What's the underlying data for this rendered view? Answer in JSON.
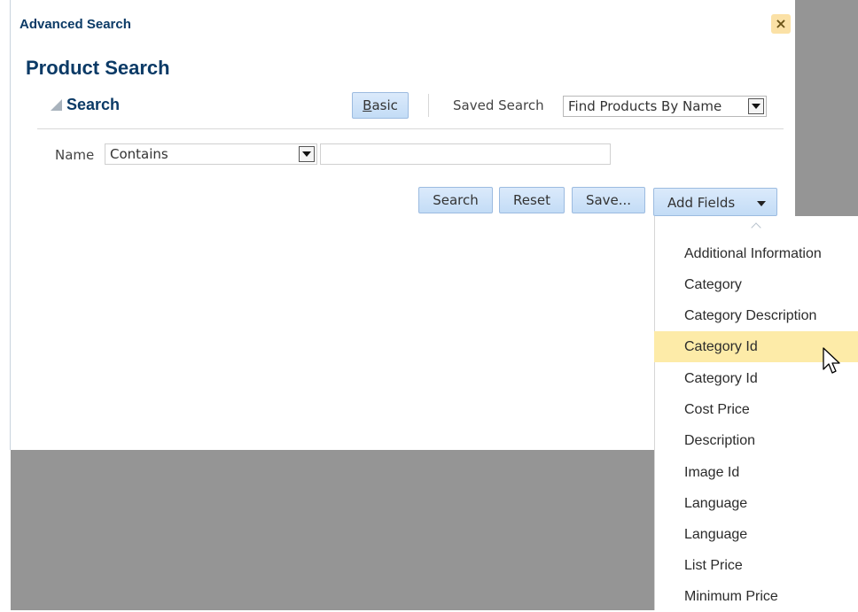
{
  "dialog": {
    "title": "Advanced Search",
    "close_icon": "×"
  },
  "page": {
    "title": "Product Search"
  },
  "search": {
    "header": "Search",
    "basic_button": {
      "u": "B",
      "rest": "asic"
    },
    "saved_search_label": "Saved Search",
    "saved_search_value": "Find Products By Name",
    "field_label": "Name",
    "operator": "Contains",
    "value": ""
  },
  "actions": {
    "search": "Search",
    "reset": "Reset",
    "save": "Save...",
    "add_fields": "Add Fields"
  },
  "add_fields_menu": {
    "items": [
      "Additional Information",
      "Category",
      "Category Description",
      "Category Id",
      "Category Id",
      "Cost Price",
      "Description",
      "Image Id",
      "Language",
      "Language",
      "List Price",
      "Minimum Price"
    ],
    "highlighted": "Category Id"
  },
  "colors": {
    "title": "#0b3a66",
    "button": "#c3dcf6",
    "highlight": "#fdeba8",
    "overlay": "#959595"
  }
}
